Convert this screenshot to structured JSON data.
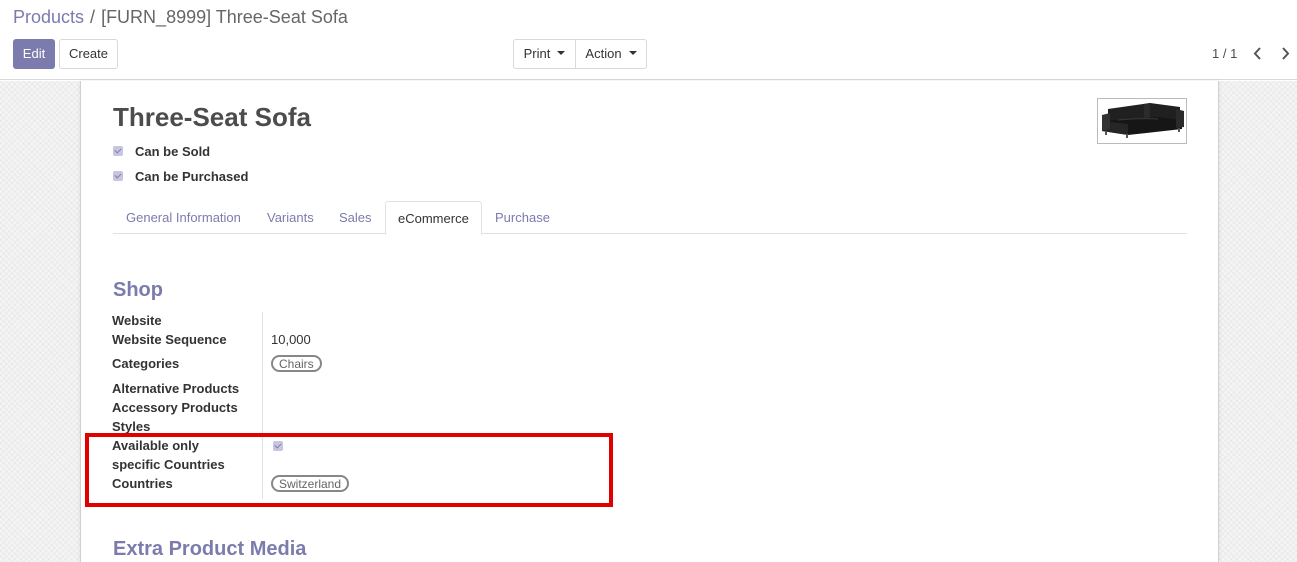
{
  "breadcrumb": {
    "parent": "Products",
    "separator": "/",
    "current": "[FURN_8999] Three-Seat Sofa"
  },
  "toolbar": {
    "edit_label": "Edit",
    "create_label": "Create",
    "print_label": "Print",
    "action_label": "Action"
  },
  "pager": {
    "value": "1 / 1"
  },
  "product": {
    "name": "Three-Seat Sofa",
    "can_be_sold_label": "Can be Sold",
    "can_be_sold": true,
    "can_be_purchased_label": "Can be Purchased",
    "can_be_purchased": true
  },
  "tabs": [
    {
      "label": "General Information"
    },
    {
      "label": "Variants"
    },
    {
      "label": "Sales"
    },
    {
      "label": "eCommerce",
      "active": true
    },
    {
      "label": "Purchase"
    }
  ],
  "shop": {
    "title": "Shop",
    "fields": {
      "website_label": "Website",
      "website_value": "",
      "sequence_label": "Website Sequence",
      "sequence_value": "10,000",
      "categories_label": "Categories",
      "categories_tag": "Chairs",
      "alternative_label": "Alternative Products",
      "accessory_label": "Accessory Products",
      "styles_label": "Styles",
      "available_label_1": "Available only",
      "available_label_2": "specific Countries",
      "available_checked": true,
      "countries_label": "Countries",
      "countries_tag": "Switzerland"
    }
  },
  "extra_media": {
    "title": "Extra Product Media"
  },
  "colors": {
    "accent": "#7c7bad",
    "highlight": "#e10000"
  },
  "icons": {
    "pager_prev": "chevron-left-icon",
    "pager_next": "chevron-right-icon",
    "caret": "caret-down-icon"
  }
}
